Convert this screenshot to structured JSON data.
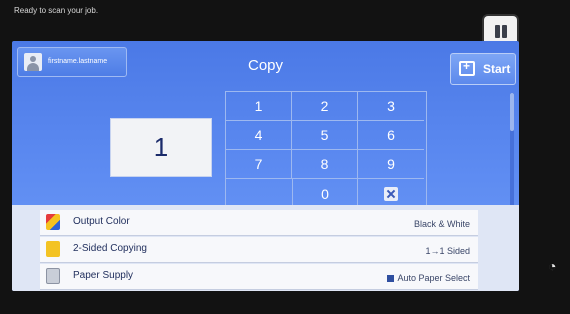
{
  "status": {
    "message": "Ready to scan your job."
  },
  "header": {
    "user_label": "firstname.lastname",
    "title": "Copy",
    "start_label": "Start"
  },
  "quantity": {
    "value": "1"
  },
  "keypad": {
    "keys": [
      "1",
      "2",
      "3",
      "4",
      "5",
      "6",
      "7",
      "8",
      "9",
      "0"
    ]
  },
  "features": [
    {
      "name": "Output Color",
      "value": "Black & White"
    },
    {
      "name": "2-Sided Copying",
      "value": "1→1 Sided"
    },
    {
      "name": "Paper Supply",
      "value": "Auto Paper Select"
    }
  ],
  "colors": {
    "screen_top": "#4b79e6",
    "screen_bottom": "#6f9cf6",
    "panel": "#dfe6f5"
  }
}
